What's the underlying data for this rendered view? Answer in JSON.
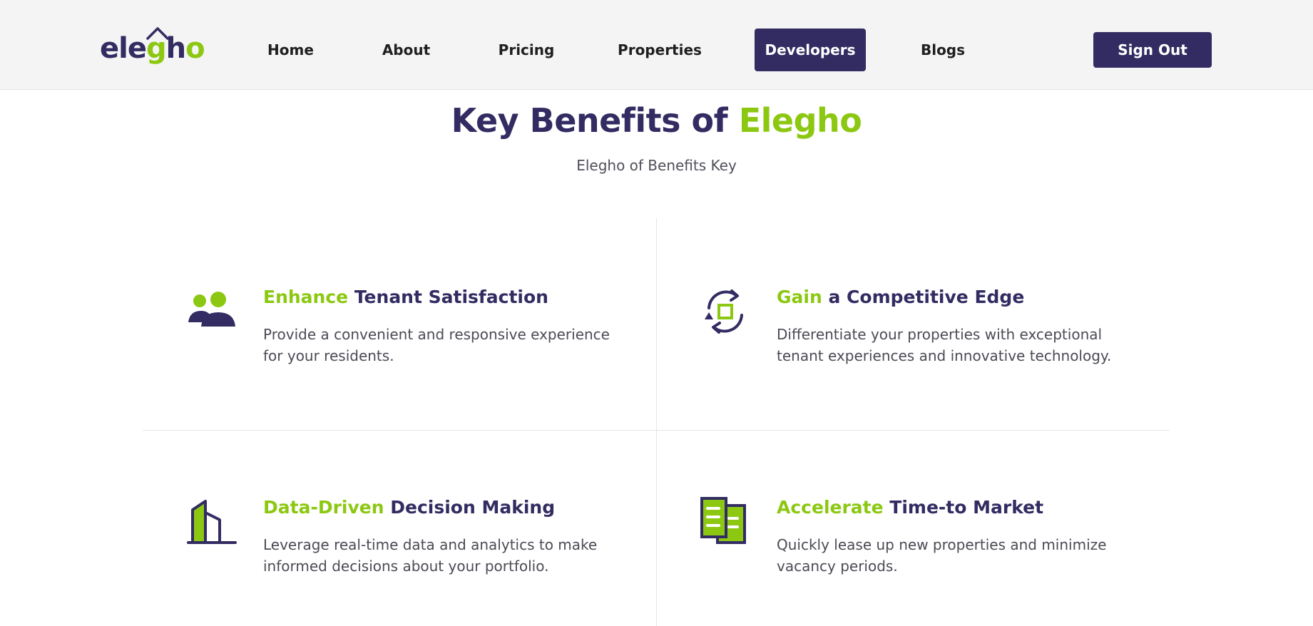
{
  "brand": {
    "logo_part1": "ele",
    "logo_part2": "g",
    "logo_part3": "h",
    "logo_part4": "o",
    "primary_color": "#322c62",
    "accent_color": "#8cc812"
  },
  "nav": {
    "items": [
      {
        "label": "Home"
      },
      {
        "label": "About"
      },
      {
        "label": "Pricing"
      },
      {
        "label": "Properties"
      },
      {
        "label": "Developers",
        "active": true
      },
      {
        "label": "Blogs"
      }
    ],
    "signout_label": "Sign Out"
  },
  "hero": {
    "title_main": "Key Benefits of ",
    "title_accent": "Elegho",
    "subtitle": "Elegho of Benefits Key"
  },
  "benefits": [
    {
      "icon": "users-icon",
      "title_accent": "Enhance",
      "title_rest": " Tenant Satisfaction",
      "description": "Provide a convenient and responsive experience for your residents."
    },
    {
      "icon": "refresh-cycle-icon",
      "title_accent": "Gain",
      "title_rest": " a Competitive Edge",
      "description": "Differentiate your properties with exceptional tenant experiences and innovative technology."
    },
    {
      "icon": "buildings-icon",
      "title_accent": "Data-Driven",
      "title_rest": " Decision Making",
      "description": "Leverage real-time data and analytics to make informed decisions about your portfolio."
    },
    {
      "icon": "documents-icon",
      "title_accent": "Accelerate",
      "title_rest": " Time-to Market",
      "description": "Quickly lease up new properties and minimize vacancy periods."
    }
  ]
}
